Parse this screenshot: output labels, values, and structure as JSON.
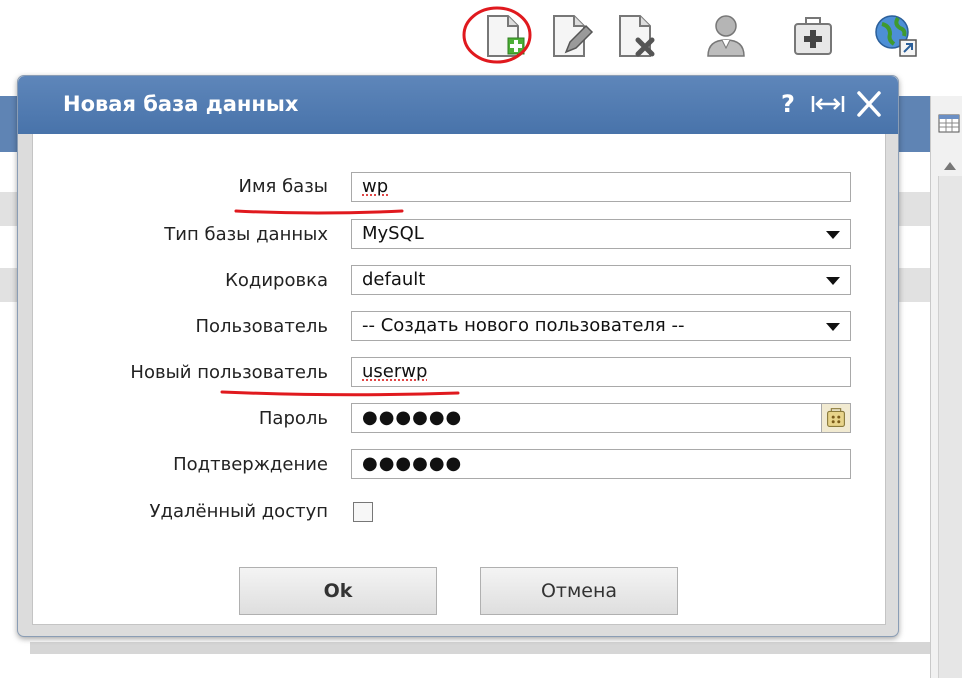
{
  "toolbar": {
    "icons": [
      "new-database-icon",
      "edit-icon",
      "delete-icon",
      "user-icon",
      "first-aid-icon",
      "globe-icon"
    ]
  },
  "dialog": {
    "title": "Новая база данных",
    "help_label": "?",
    "resize_label": "|↔|",
    "close_label": "✕",
    "fields": {
      "db_name": {
        "label": "Имя базы",
        "value": "wp"
      },
      "db_type": {
        "label": "Тип базы данных",
        "value": "MySQL"
      },
      "encoding": {
        "label": "Кодировка",
        "value": "default"
      },
      "user": {
        "label": "Пользователь",
        "value": "-- Создать нового пользователя --"
      },
      "new_user": {
        "label": "Новый пользователь",
        "value": "userwp"
      },
      "password": {
        "label": "Пароль",
        "value": "●●●●●●"
      },
      "confirm": {
        "label": "Подтверждение",
        "value": "●●●●●●"
      },
      "remote_access": {
        "label": "Удалённый доступ",
        "checked": false
      }
    },
    "ok_label": "Ok",
    "cancel_label": "Отмена"
  },
  "colors": {
    "title_bar": "#5576a8",
    "annotation": "#e0191e"
  }
}
